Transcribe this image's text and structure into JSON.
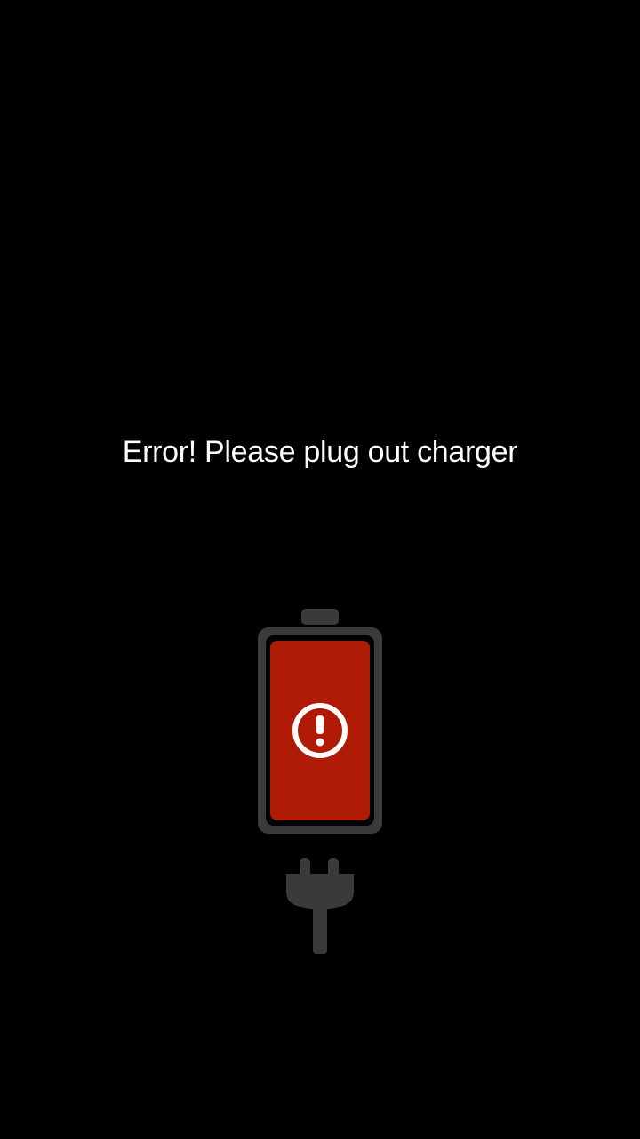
{
  "screen": {
    "message": "Error! Please plug out charger"
  },
  "icons": {
    "battery": "battery-error-icon",
    "alert": "exclamation-circle-icon",
    "plug": "charger-plug-icon"
  },
  "colors": {
    "background": "#000000",
    "text": "#ffffff",
    "battery_shell": "#3a3a3a",
    "battery_fill": "#b01b08",
    "alert_symbol": "#ffffff",
    "plug": "#3a3a3a"
  }
}
